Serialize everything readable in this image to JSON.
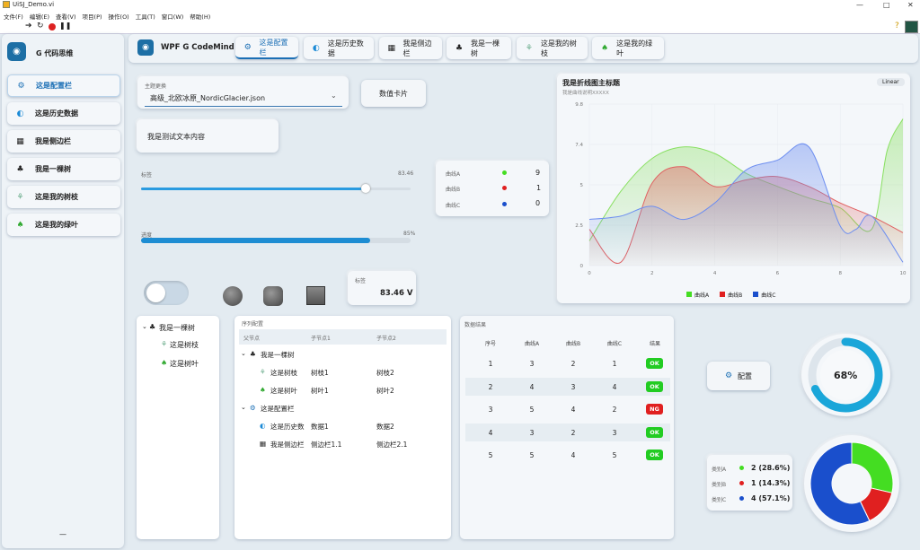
{
  "window": {
    "title": "UiSJ_Demo.vi",
    "min": "—",
    "max": "□",
    "close": "✕"
  },
  "menu": [
    "文件(F)",
    "编辑(E)",
    "查看(V)",
    "项目(P)",
    "操作(O)",
    "工具(T)",
    "窗口(W)",
    "帮助(H)"
  ],
  "sidebar": {
    "brand": "G 代码思维",
    "items": [
      {
        "label": "这是配置栏",
        "icon": "gear-icon"
      },
      {
        "label": "这是历史数据",
        "icon": "moon-icon"
      },
      {
        "label": "我是侧边栏",
        "icon": "grid-icon"
      },
      {
        "label": "我是一棵树",
        "icon": "tree-icon"
      },
      {
        "label": "这是我的树枝",
        "icon": "branch-icon"
      },
      {
        "label": "这是我的绿叶",
        "icon": "leaf-icon"
      }
    ],
    "footer": "—"
  },
  "header": {
    "brand": "WPF G CodeMind",
    "tabs": [
      "这是配置栏",
      "这是历史数据",
      "我是侧边栏",
      "我是一棵树",
      "这是我的树枝",
      "这是我的绿叶"
    ]
  },
  "theme": {
    "label": "主题更换",
    "value": "高级_北欧冰原_NordicGlacier.json",
    "button": "数值卡片"
  },
  "textcard": "我是测试文本内容",
  "slider": {
    "label": "标签",
    "value": "83.46",
    "fraction": 0.8346
  },
  "progress": {
    "label": "进度",
    "value": "85%",
    "fraction": 0.85
  },
  "valuecard": {
    "label": "标签",
    "value": "83.46 V"
  },
  "legendcard": [
    {
      "name": "曲线A",
      "color": "#44dd22",
      "value": "9"
    },
    {
      "name": "曲线B",
      "color": "#e02020",
      "value": "1"
    },
    {
      "name": "曲线C",
      "color": "#1a4fcc",
      "value": "0"
    }
  ],
  "chart_data": {
    "type": "area",
    "title": "我是折线图主标题",
    "subtitle": "我是曲线说明XXXXX",
    "badge": "Linear",
    "xlim": [
      0,
      10
    ],
    "ylim": [
      0,
      9.8
    ],
    "xticks": [
      "0",
      "2",
      "4",
      "6",
      "8",
      "10"
    ],
    "yticks": [
      "0",
      "2.5",
      "5",
      "7.4",
      "9.8"
    ],
    "series": [
      {
        "name": "曲线A",
        "color": "#88e060",
        "x": [
          0,
          1,
          2,
          3,
          4,
          5,
          6,
          7,
          8,
          9,
          9.5,
          10
        ],
        "y": [
          1.5,
          4.5,
          6.5,
          7.2,
          6.8,
          5.6,
          4.8,
          4.1,
          3.5,
          2.2,
          7.0,
          8.9
        ]
      },
      {
        "name": "曲线B",
        "color": "#e06060",
        "x": [
          0,
          1,
          2,
          3,
          4,
          5,
          6,
          7,
          8,
          9,
          10
        ],
        "y": [
          2.2,
          0.2,
          5.0,
          6.0,
          4.8,
          5.2,
          5.4,
          4.8,
          3.8,
          3.0,
          2.0
        ]
      },
      {
        "name": "曲线C",
        "color": "#6d8ef0",
        "x": [
          0,
          1,
          2,
          3,
          4,
          5,
          6,
          7,
          8,
          8.5,
          9,
          10
        ],
        "y": [
          2.8,
          3.0,
          3.6,
          2.8,
          3.8,
          5.8,
          6.4,
          7.2,
          2.4,
          2.2,
          3.0,
          0.2
        ]
      }
    ]
  },
  "tree": {
    "root": "我是一棵树",
    "children": [
      "这是树枝",
      "这是树叶"
    ]
  },
  "tree_table": {
    "title": "序列配置",
    "headers": [
      "父节点",
      "子节点1",
      "子节点2"
    ],
    "rows": [
      {
        "label": "我是一棵树",
        "icon": "tree-icon",
        "c1": "",
        "c2": "",
        "level": 0
      },
      {
        "label": "这是树枝",
        "icon": "branch-icon",
        "c1": "树枝1",
        "c2": "树枝2",
        "level": 1
      },
      {
        "label": "这是树叶",
        "icon": "leaf-icon",
        "c1": "树叶1",
        "c2": "树叶2",
        "level": 1
      },
      {
        "label": "这是配置栏",
        "icon": "gear-icon",
        "c1": "",
        "c2": "",
        "level": 0
      },
      {
        "label": "这是历史数",
        "icon": "moon-icon",
        "c1": "数据1",
        "c2": "数据2",
        "level": 1
      },
      {
        "label": "我是侧边栏",
        "icon": "grid-icon",
        "c1": "侧边栏1.1",
        "c2": "侧边栏2.1",
        "level": 1
      }
    ]
  },
  "data_table": {
    "title": "数据结果",
    "headers": [
      "序号",
      "曲线A",
      "曲线B",
      "曲线C",
      "结果"
    ],
    "rows": [
      [
        "1",
        "3",
        "2",
        "1",
        "OK"
      ],
      [
        "2",
        "4",
        "3",
        "4",
        "OK"
      ],
      [
        "3",
        "5",
        "4",
        "2",
        "NG"
      ],
      [
        "4",
        "3",
        "2",
        "3",
        "OK"
      ],
      [
        "5",
        "5",
        "4",
        "5",
        "OK"
      ]
    ]
  },
  "config_button": "配置",
  "gauge": {
    "value": "68%",
    "fraction": 0.68,
    "color": "#1aa6d9"
  },
  "pie": {
    "items": [
      {
        "name": "类别A",
        "color": "#44dd22",
        "value": "2 (28.6%)",
        "fraction": 0.286
      },
      {
        "name": "类别B",
        "color": "#e02020",
        "value": "1 (14.3%)",
        "fraction": 0.143
      },
      {
        "name": "类别C",
        "color": "#1a4fcc",
        "value": "4 (57.1%)",
        "fraction": 0.571
      }
    ]
  }
}
